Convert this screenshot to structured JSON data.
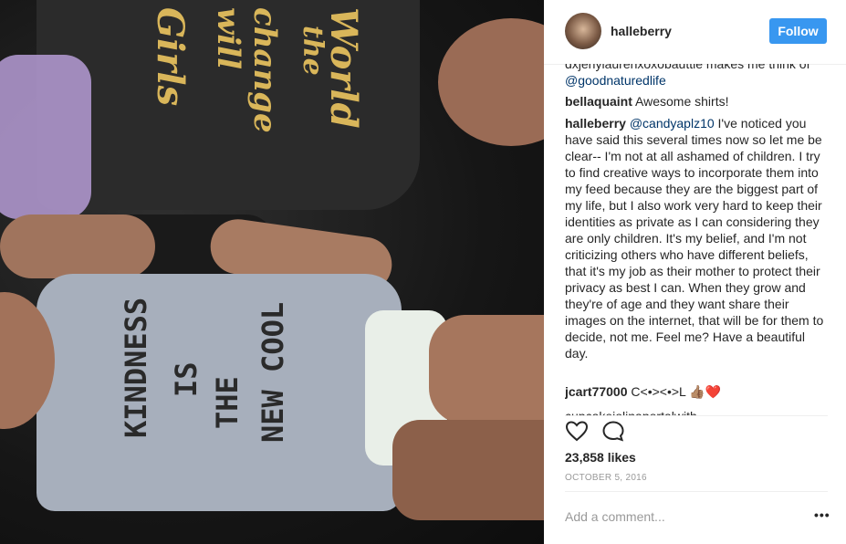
{
  "photo": {
    "shirt_top_text": [
      "Girls",
      "will",
      "change",
      "the",
      "World"
    ],
    "shirt_bottom_text": [
      "KINDNESS",
      "IS",
      "THE",
      "NEW COOL"
    ]
  },
  "header": {
    "username": "halleberry",
    "follow_label": "Follow"
  },
  "comments": {
    "partial_top": "dxjenylaurenxoxobauttle makes me think of",
    "partial_top_link": "@goodnaturedlife",
    "items": [
      {
        "user": "bellaquaint",
        "text": "Awesome shirts!"
      },
      {
        "user": "halleberry",
        "mention": "@candyaplz10",
        "text": "I've noticed you have said this several times now so let me be clear-- I'm not at all ashamed of children. I try to find creative ways to incorporate them into my feed because they are the biggest part of my life, but I also work very hard to keep their identities as private as I can considering they are only children. It's my belief, and I'm not criticizing others who have different beliefs, that it's my job as their mother to protect their privacy as best I can. When they grow and they're of age and they want share their images on the internet, that will be for them to decide, not me. Feel me? Have a beautiful day."
      },
      {
        "user": "jcart77000",
        "text": "C<•><•>L 👍🏽❤️"
      }
    ],
    "partial_bottom": "cupcakejolinaportalwith"
  },
  "actions": {
    "like_icon": "heart-icon",
    "comment_icon": "comment-bubble-icon"
  },
  "likes": "23,858 likes",
  "date": "OCTOBER 5, 2016",
  "add_comment": {
    "placeholder": "Add a comment...",
    "more_icon": "more-options-icon",
    "more_glyph": "•••"
  },
  "colors": {
    "follow_button": "#3897f0",
    "link": "#003569",
    "muted": "#999999"
  }
}
